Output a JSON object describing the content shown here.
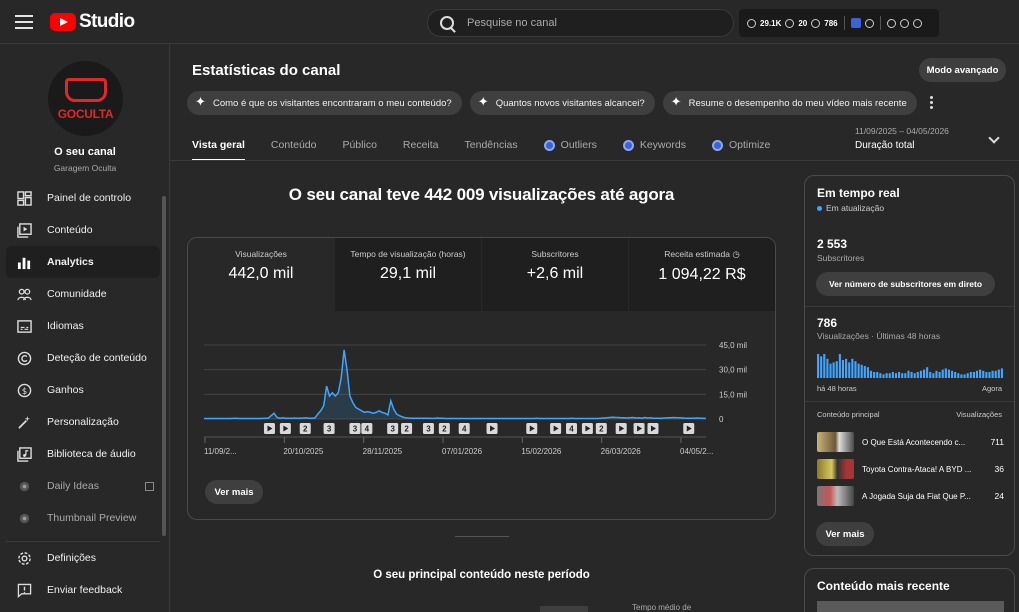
{
  "app": {
    "brand": "Studio",
    "search_placeholder": "Pesquise no canal",
    "ext": {
      "views": "29.1K",
      "stat2": "20",
      "stat3": "786"
    }
  },
  "channel": {
    "name": "O seu canal",
    "handle": "Garagem Oculta",
    "avatar_text": "GOCULTA"
  },
  "sidebar": {
    "items": [
      {
        "label": "Painel de controlo",
        "icon": "dashboard-icon"
      },
      {
        "label": "Conteúdo",
        "icon": "content-icon"
      },
      {
        "label": "Analytics",
        "icon": "analytics-icon"
      },
      {
        "label": "Comunidade",
        "icon": "community-icon"
      },
      {
        "label": "Idiomas",
        "icon": "subtitles-icon"
      },
      {
        "label": "Deteção de conteúdo",
        "icon": "copyright-icon"
      },
      {
        "label": "Ganhos",
        "icon": "dollar-icon"
      },
      {
        "label": "Personalização",
        "icon": "magic-wand-icon"
      },
      {
        "label": "Biblioteca de áudio",
        "icon": "audio-library-icon"
      },
      {
        "label": "Daily Ideas",
        "icon": "extension-icon"
      },
      {
        "label": "Thumbnail Preview",
        "icon": "extension-icon"
      }
    ],
    "bottom": [
      {
        "label": "Definições",
        "icon": "gear-icon"
      },
      {
        "label": "Enviar feedback",
        "icon": "feedback-icon"
      }
    ]
  },
  "header": {
    "title": "Estatísticas do canal",
    "advanced_button": "Modo avançado",
    "chips": [
      "Como é que os visitantes encontraram o meu conteúdo?",
      "Quantos novos visitantes alcancei?",
      "Resume o desempenho do meu vídeo mais recente"
    ],
    "tabs": [
      "Vista geral",
      "Conteúdo",
      "Público",
      "Receita",
      "Tendências",
      "Outliers",
      "Keywords",
      "Optimize"
    ],
    "date_range": "11/09/2025 – 04/05/2026",
    "date_label": "Duração total"
  },
  "overview": {
    "headline": "O seu canal teve 442 009 visualizações até agora",
    "metrics": [
      {
        "label": "Visualizações",
        "value": "442,0 mil"
      },
      {
        "label": "Tempo de visualização (horas)",
        "value": "29,1 mil"
      },
      {
        "label": "Subscritores",
        "value": "+2,6 mil"
      },
      {
        "label": "Receita estimada",
        "value": "1 094,22 R$"
      }
    ],
    "more_button": "Ver mais",
    "section_title": "O seu principal conteúdo neste período",
    "cut_text": "Tempo médio de"
  },
  "chart_data": {
    "type": "line",
    "x_tick_labels": [
      "11/09/2...",
      "20/10/2025",
      "28/11/2025",
      "07/01/2026",
      "15/02/2026",
      "26/03/2026",
      "04/05/2..."
    ],
    "y_tick_labels": [
      "45,0 mil",
      "30,0 mil",
      "15,0 mil",
      "0"
    ],
    "ylim": [
      0,
      45000
    ],
    "series_color": "#3ea6ff",
    "values": [
      300,
      300,
      300,
      300,
      300,
      300,
      300,
      300,
      300,
      300,
      350,
      400,
      300,
      300,
      300,
      300,
      300,
      300,
      300,
      300,
      350,
      400,
      500,
      2000,
      3500,
      1000,
      500,
      800,
      500,
      400,
      500,
      600,
      400,
      500,
      600,
      800,
      500,
      400,
      600,
      3000,
      5000,
      8000,
      20000,
      14000,
      16000,
      14000,
      16000,
      25000,
      42000,
      30000,
      14000,
      10000,
      7000,
      6000,
      5000,
      4000,
      4500,
      4000,
      3500,
      4000,
      5000,
      4000,
      3500,
      2500,
      11000,
      6000,
      3000,
      2000,
      1200,
      800,
      600,
      500,
      500,
      400,
      400,
      500,
      400,
      400,
      350,
      400,
      600,
      500,
      400,
      300,
      300,
      300,
      300,
      300,
      300,
      300,
      300,
      300,
      300,
      300,
      300,
      300,
      300,
      300,
      300,
      300,
      300,
      300,
      300,
      300,
      300,
      300,
      300,
      300,
      300,
      300,
      300,
      300,
      300,
      300,
      400,
      300,
      300,
      300,
      300,
      300,
      300,
      300,
      300,
      300,
      300,
      300,
      400,
      300,
      300,
      300,
      300,
      300,
      300,
      300,
      300,
      300,
      500,
      600,
      700,
      900,
      1100,
      1000,
      900,
      800,
      700,
      600,
      800,
      900,
      600,
      700,
      500,
      900,
      600,
      700,
      500,
      400,
      400,
      500,
      600,
      700,
      800,
      900,
      800,
      700,
      600,
      500,
      400,
      400,
      500,
      600,
      500,
      400,
      300
    ],
    "markers": [
      "play",
      "play",
      "2",
      "3",
      "3",
      "4",
      "3",
      "2",
      "3",
      "2",
      "4",
      "play",
      "play",
      "play",
      "4",
      "play",
      "2",
      "play",
      "play",
      "play",
      "play"
    ]
  },
  "realtime": {
    "title": "Em tempo real",
    "live_label": "Em atualização",
    "subs_value": "2 553",
    "subs_label": "Subscritores",
    "subs_button": "Ver número de subscritores em direto",
    "views_value": "786",
    "views_label": "Visualizações · Últimas 48 horas",
    "axis_left": "há 48 horas",
    "axis_right": "Agora",
    "bars": [
      20,
      18,
      20,
      16,
      12,
      13,
      14,
      20,
      15,
      16,
      13,
      16,
      14,
      12,
      11,
      10,
      9,
      6,
      5,
      5,
      4,
      3,
      4,
      4,
      5,
      4,
      5,
      4,
      4,
      6,
      5,
      4,
      5,
      6,
      7,
      9,
      5,
      4,
      6,
      5,
      7,
      8,
      7,
      6,
      5,
      4,
      3,
      3,
      4,
      5,
      5,
      6,
      7,
      6,
      5,
      5,
      6,
      6,
      7,
      8
    ],
    "table_header_left": "Conteúdo principal",
    "table_header_right": "Visualizações",
    "rows": [
      {
        "title": "O Que Está Acontecendo c...",
        "views": "711"
      },
      {
        "title": "Toyota Contra-Ataca! A BYD ...",
        "views": "36"
      },
      {
        "title": "A Jogada Suja da Fiat Que P...",
        "views": "24"
      }
    ],
    "more_button": "Ver mais"
  },
  "recent": {
    "title": "Conteúdo mais recente"
  }
}
